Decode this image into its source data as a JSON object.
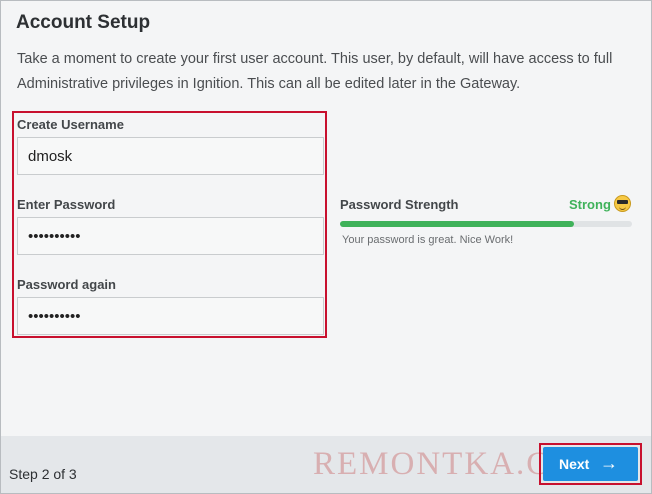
{
  "page": {
    "title": "Account Setup",
    "description": "Take a moment to create your first user account. This user, by default, will have access to full Administrative privileges in Ignition. This can all be edited later in the Gateway."
  },
  "form": {
    "username_label": "Create Username",
    "username_value": "dmosk",
    "password_label": "Enter Password",
    "password_value": "••••••••••",
    "password_again_label": "Password again",
    "password_again_value": "••••••••••"
  },
  "strength": {
    "label": "Password Strength",
    "value": "Strong",
    "message": "Your password is great. Nice Work!",
    "level_percent": 80,
    "icon": "sunglasses-emoji-icon",
    "color": "#3fb25a"
  },
  "footer": {
    "step": "Step 2 of 3",
    "next_label": "Next",
    "next_icon": "arrow-right-icon",
    "watermark": "REMONTKA.COM"
  },
  "colors": {
    "accent": "#1e8fe0",
    "highlight": "#c8102e"
  }
}
